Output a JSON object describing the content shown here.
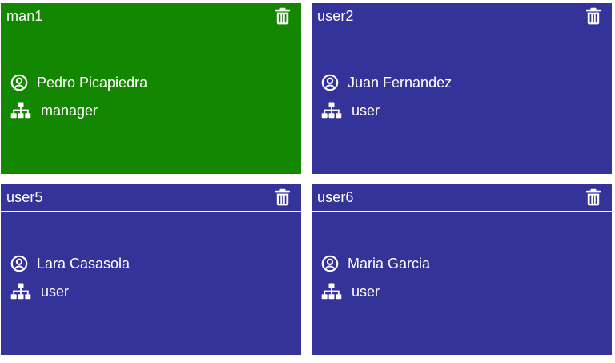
{
  "colors": {
    "manager_card": "#148700",
    "user_card": "#343399",
    "foreground": "#ffffff"
  },
  "icons": {
    "delete": "trash-icon",
    "name": "user-circle-icon",
    "role": "sitemap-icon"
  },
  "cards": [
    {
      "username": "man1",
      "full_name": "Pedro Picapiedra",
      "role": "manager",
      "bg": "#148700"
    },
    {
      "username": "user2",
      "full_name": "Juan Fernandez",
      "role": "user",
      "bg": "#343399"
    },
    {
      "username": "user5",
      "full_name": "Lara Casasola",
      "role": "user",
      "bg": "#343399"
    },
    {
      "username": "user6",
      "full_name": "Maria Garcia",
      "role": "user",
      "bg": "#343399"
    }
  ]
}
